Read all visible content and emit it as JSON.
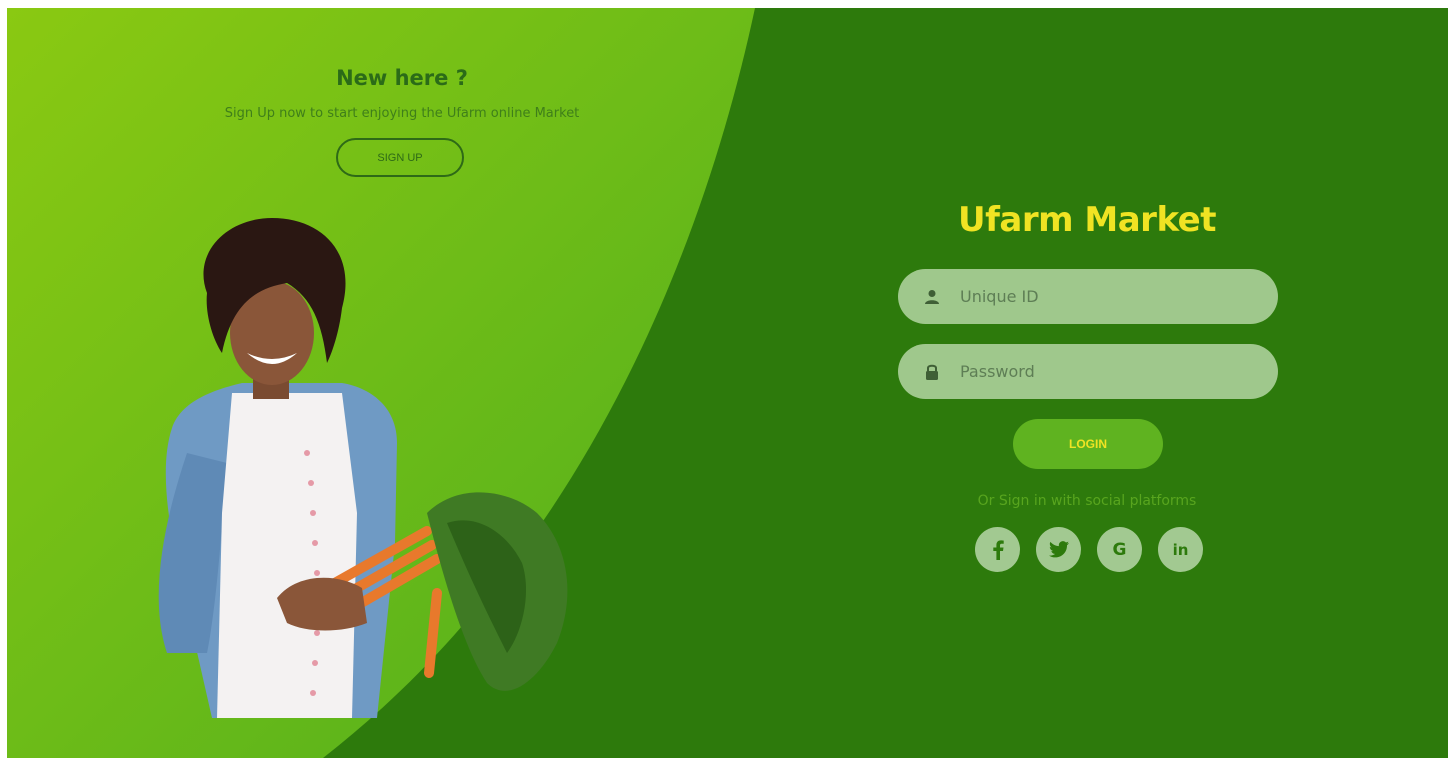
{
  "left": {
    "heading": "New here ?",
    "subtext": "Sign Up now to start enjoying the Ufarm online Market",
    "signup_label": "SIGN UP"
  },
  "right": {
    "brand": "Ufarm Market",
    "unique_id_placeholder": "Unique ID",
    "password_placeholder": "Password",
    "login_label": "LOGIN",
    "social_text": "Or Sign in with social platforms",
    "socials": [
      {
        "icon": "facebook-icon",
        "glyph": "f"
      },
      {
        "icon": "twitter-icon",
        "glyph": "🐦"
      },
      {
        "icon": "google-icon",
        "glyph": "G"
      },
      {
        "icon": "linkedin-icon",
        "glyph": "in"
      }
    ]
  },
  "colors": {
    "dark_green": "#2d7a0c",
    "light_green_start": "#8ac912",
    "light_green_end": "#5cb41f",
    "accent_yellow": "#f0e323",
    "field_bg": "#9fc88c",
    "login_bg": "#5fb320"
  }
}
